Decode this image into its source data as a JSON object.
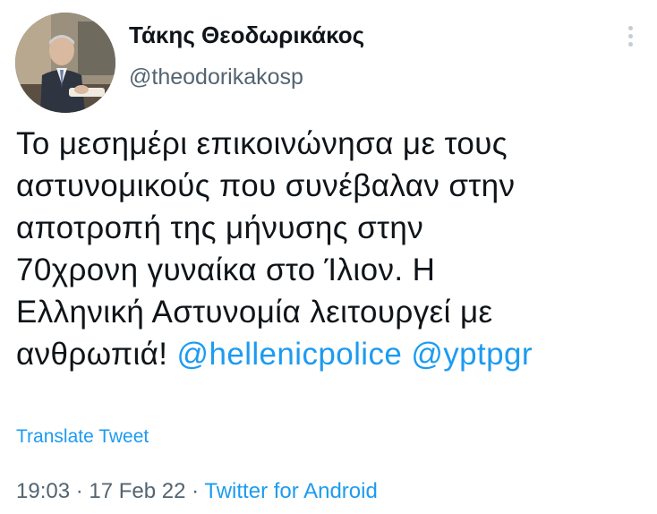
{
  "author": {
    "display_name": "Τάκης Θεοδωρικάκος",
    "handle": "@theodorikakosp",
    "avatar_icon": "profile-photo"
  },
  "tweet": {
    "lines": [
      "Το μεσημέρι επικοινώνησα με τους",
      "αστυνομικούς που συνέβαλαν στην",
      "αποτροπή της μήνυσης στην",
      "70χρονη γυναίκα στο Ίλιον. Η",
      "Ελληνική Αστυνομία λειτουργεί με",
      "ανθρωπιά! "
    ],
    "mentions": [
      "@hellenicpolice",
      "@yptpgr"
    ],
    "translate_label": "Translate Tweet"
  },
  "meta": {
    "time": "19:03",
    "separator": " · ",
    "date": "17 Feb 22",
    "source": "Twitter for Android"
  },
  "colors": {
    "link": "#1d9bf0",
    "secondary_text": "#536471",
    "primary_text": "#0f1419"
  }
}
